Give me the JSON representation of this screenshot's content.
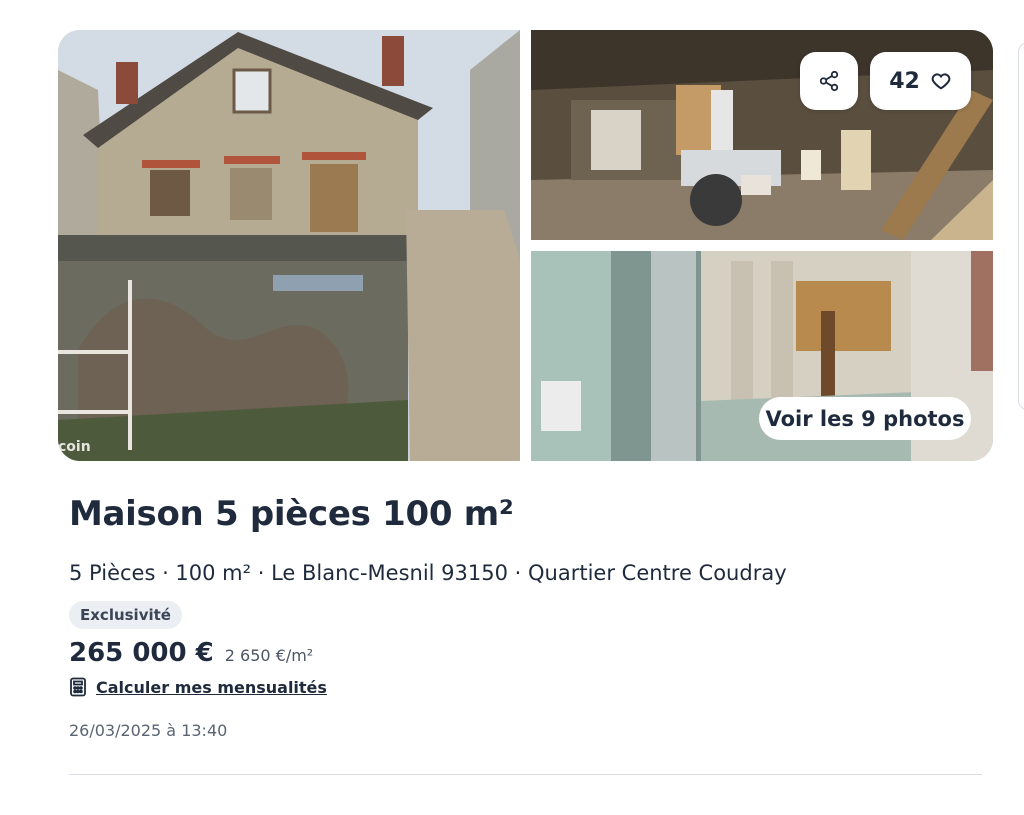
{
  "gallery": {
    "watermark": "coin",
    "favorite_count": "42",
    "photos_button_label": "Voir les 9 photos",
    "icons": {
      "share": "share-icon",
      "favorite": "heart-outline-icon"
    }
  },
  "listing": {
    "title": "Maison 5 pièces 100 m²",
    "subtitle": "5 Pièces · 100 m² · Le Blanc-Mesnil 93150 · Quartier Centre Coudray",
    "badge": "Exclusivité",
    "price": "265 000 €",
    "price_per_sqm": "2 650 €/m²",
    "calculator_link": "Calculer mes mensualités",
    "calculator_icon": "calculator-icon",
    "posted_at": "26/03/2025 à 13:40"
  },
  "colors": {
    "text": "#1f2b3d",
    "badge_bg": "#ebeef3",
    "divider": "#d9dde3"
  }
}
